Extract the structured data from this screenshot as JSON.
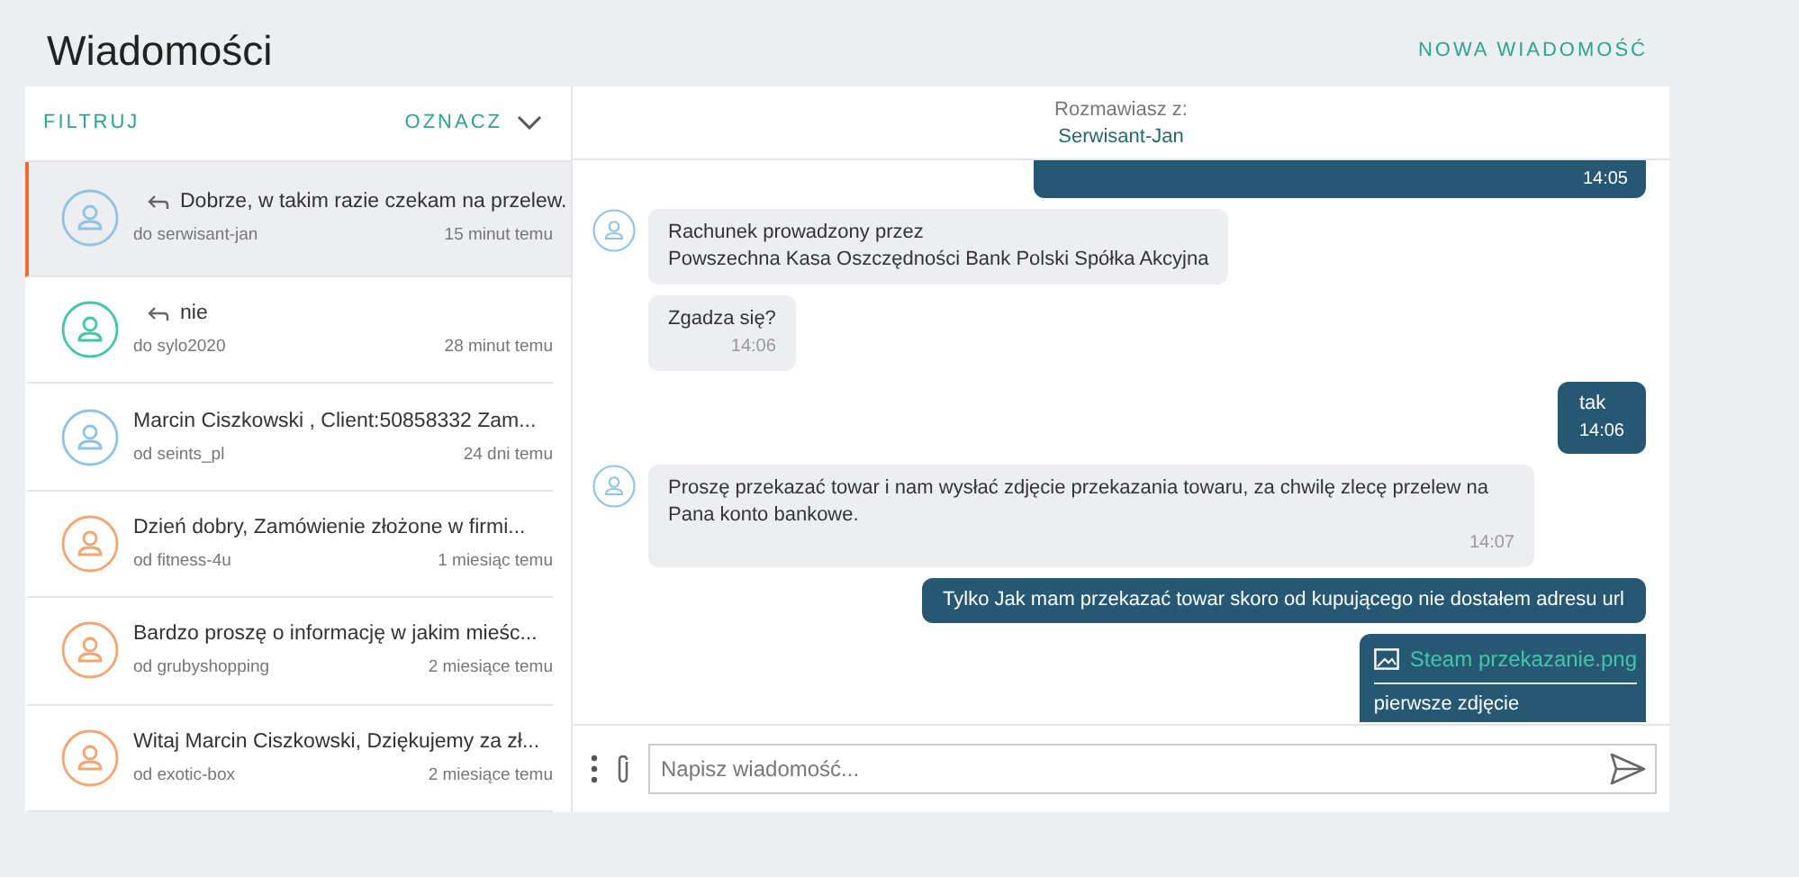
{
  "page_title": "Wiadomości",
  "new_message_button": "NOWA WIADOMOŚĆ",
  "list_header": {
    "filter": "FILTRUJ",
    "mark": "OZNACZ"
  },
  "conversations": [
    {
      "text": "Dobrze, w takim razie czekam na przelew.",
      "replied": true,
      "who": "do serwisant-jan",
      "time": "15 minut temu",
      "color": "#8ec3e6",
      "selected": true
    },
    {
      "text": "nie",
      "replied": true,
      "who": "do sylo2020",
      "time": "28 minut temu",
      "color": "#3fc7a8",
      "selected": false
    },
    {
      "text": "Marcin Ciszkowski , Client:50858332 Zam...",
      "replied": false,
      "who": "od seints_pl",
      "time": "24 dni temu",
      "color": "#8ec3e6",
      "selected": false
    },
    {
      "text": "Dzień dobry, Zamówienie złożone w firmi...",
      "replied": false,
      "who": "od fitness-4u",
      "time": "1 miesiąc temu",
      "color": "#f5a46f",
      "selected": false
    },
    {
      "text": "Bardzo proszę o informację w jakim mieśc...",
      "replied": false,
      "who": "od grubyshopping",
      "time": "2 miesiące temu",
      "color": "#f5a46f",
      "selected": false
    },
    {
      "text": "Witaj Marcin Ciszkowski, Dziękujemy za zł...",
      "replied": false,
      "who": "od exotic-box",
      "time": "2 miesiące temu",
      "color": "#f5a46f",
      "selected": false
    }
  ],
  "thread": {
    "with_label": "Rozmawiasz z:",
    "with_name": "Serwisant-Jan",
    "messages": [
      {
        "kind": "out",
        "time": "14:05"
      },
      {
        "kind": "in",
        "avatar": true,
        "lines": [
          "Rachunek prowadzony przez",
          "Powszechna Kasa Oszczędności Bank Polski Spółka Akcyjna"
        ]
      },
      {
        "kind": "in",
        "avatar": false,
        "lines": [
          "Zgadza się?"
        ],
        "time": "14:06"
      },
      {
        "kind": "out",
        "lines": [
          "tak"
        ],
        "time": "14:06"
      },
      {
        "kind": "in",
        "avatar": true,
        "lines": [
          "Proszę przekazać towar i nam wysłać zdjęcie przekazania towaru, za chwilę zlecę przelew na Pana konto bankowe."
        ],
        "time": "14:07"
      },
      {
        "kind": "out",
        "lines": [
          "Tylko Jak mam przekazać towar skoro od kupującego nie dostałem adresu url"
        ]
      },
      {
        "kind": "attachment",
        "file": "Steam przekazanie.png",
        "caption": "pierwsze zdjęcie"
      }
    ]
  },
  "composer": {
    "placeholder": "Napisz wiadomość..."
  }
}
